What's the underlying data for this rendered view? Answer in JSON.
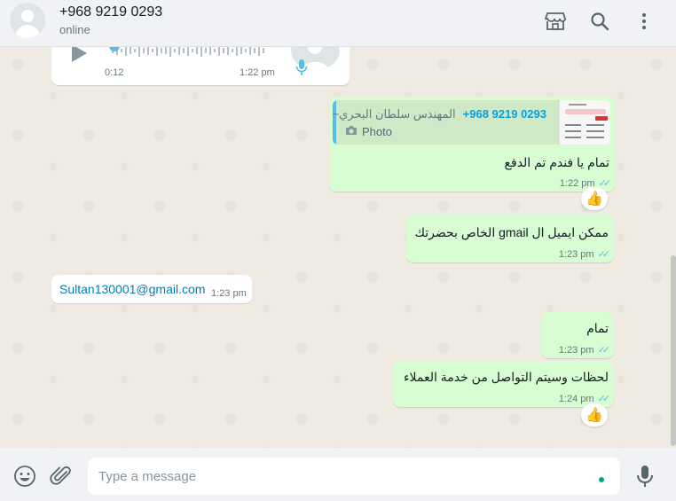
{
  "header": {
    "contact_name": "+968 9219 0293",
    "status": "online",
    "icons": [
      "shop-icon",
      "search-icon",
      "menu-icon"
    ]
  },
  "messages": {
    "voice": {
      "duration": "0:12",
      "time": "1:22 pm"
    },
    "reply": {
      "quote_author": "~المهندس سلطان البحري",
      "quote_number": "+968 9219 0293",
      "quote_label": "Photo",
      "text": "تمام يا فندم تم الدفع",
      "time": "1:22 pm"
    },
    "gmail_request": {
      "text": "ممكن ايميل ال gmail الخاص بحضرتك",
      "time": "1:23 pm"
    },
    "email": {
      "text": "Sultan130001@gmail.com",
      "time": "1:23 pm"
    },
    "ok": {
      "text": "تمام",
      "time": "1:23 pm"
    },
    "final": {
      "text": "لحظات وسيتم التواصل من خدمة العملاء",
      "time": "1:24 pm"
    }
  },
  "composer": {
    "placeholder": "Type a message"
  },
  "colors": {
    "outgoing": "#d9fdd3",
    "incoming": "#ffffff",
    "accent": "#53bdeb",
    "header": "#f0f2f5"
  }
}
